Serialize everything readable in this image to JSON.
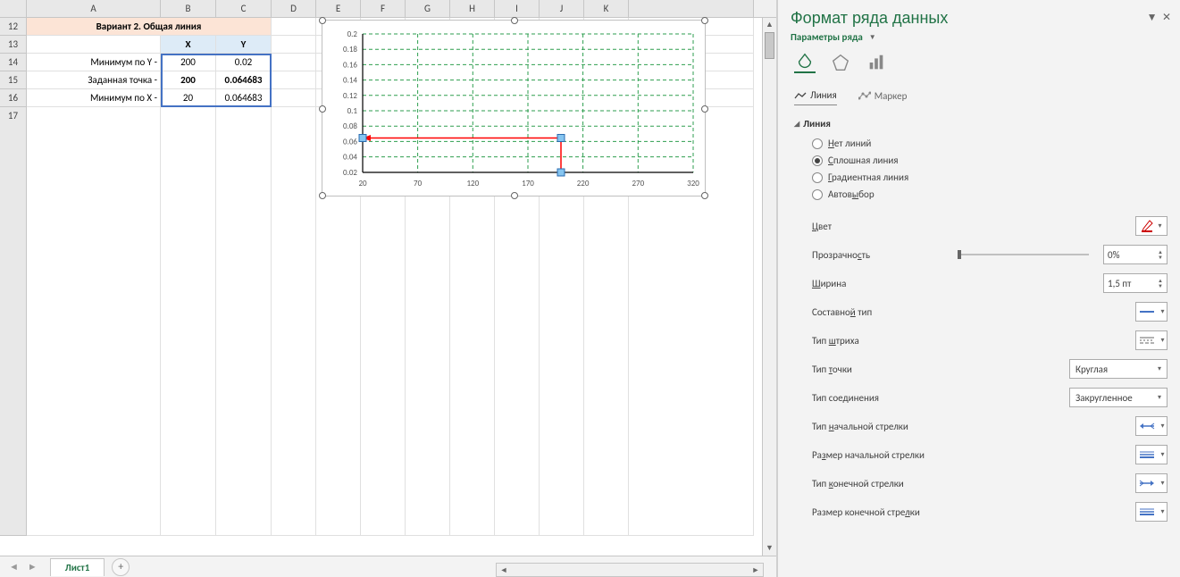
{
  "spreadsheet": {
    "columns": [
      "A",
      "B",
      "C",
      "D",
      "E",
      "F",
      "G",
      "H",
      "I",
      "J",
      "K"
    ],
    "visible_rows": [
      "12",
      "13",
      "14",
      "15",
      "16",
      "17"
    ],
    "title": "Вариант 2. Общая линия",
    "headers": {
      "x": "X",
      "y": "Y"
    },
    "rows": [
      {
        "label": "Минимум по Y -",
        "x": "200",
        "y": "0.02"
      },
      {
        "label": "Заданная точка -",
        "x": "200",
        "y": "0.064683"
      },
      {
        "label": "Минимум по X -",
        "x": "20",
        "y": "0.064683"
      }
    ],
    "sheet_tab": "Лист1"
  },
  "chart_data": {
    "type": "line",
    "title": "",
    "xlabel": "",
    "ylabel": "",
    "xlim": [
      20,
      320
    ],
    "ylim": [
      0.02,
      0.2
    ],
    "x_ticks": [
      20,
      70,
      120,
      170,
      220,
      270,
      320
    ],
    "y_ticks": [
      0.02,
      0.04,
      0.06,
      0.08,
      0.1,
      0.12,
      0.14,
      0.16,
      0.18,
      0.2
    ],
    "series": [
      {
        "name": "Общая линия",
        "x": [
          200,
          200,
          20
        ],
        "y": [
          0.02,
          0.064683,
          0.064683
        ],
        "color": "#ff0000"
      }
    ]
  },
  "format_pane": {
    "title": "Формат ряда данных",
    "subtitle": "Параметры ряда",
    "tabs": {
      "line": "Линия",
      "marker": "Маркер"
    },
    "section": "Линия",
    "radios": {
      "none": "Нет линий",
      "solid": "Сплошная линия",
      "gradient": "Градиентная линия",
      "auto": "Автовыбор",
      "selected": "solid"
    },
    "props": {
      "color_label": "Цвет",
      "transparency_label": "Прозрачность",
      "transparency_value": "0%",
      "width_label": "Ширина",
      "width_value": "1,5 пт",
      "compound_label": "Составной тип",
      "dash_label": "Тип штриха",
      "cap_label": "Тип точки",
      "cap_value": "Круглая",
      "join_label": "Тип соединения",
      "join_value": "Закругленное",
      "begin_arrow_type": "Тип начальной стрелки",
      "begin_arrow_size": "Размер начальной стрелки",
      "end_arrow_type": "Тип конечной стрелки",
      "end_arrow_size": "Размер конечной стрелки"
    }
  }
}
